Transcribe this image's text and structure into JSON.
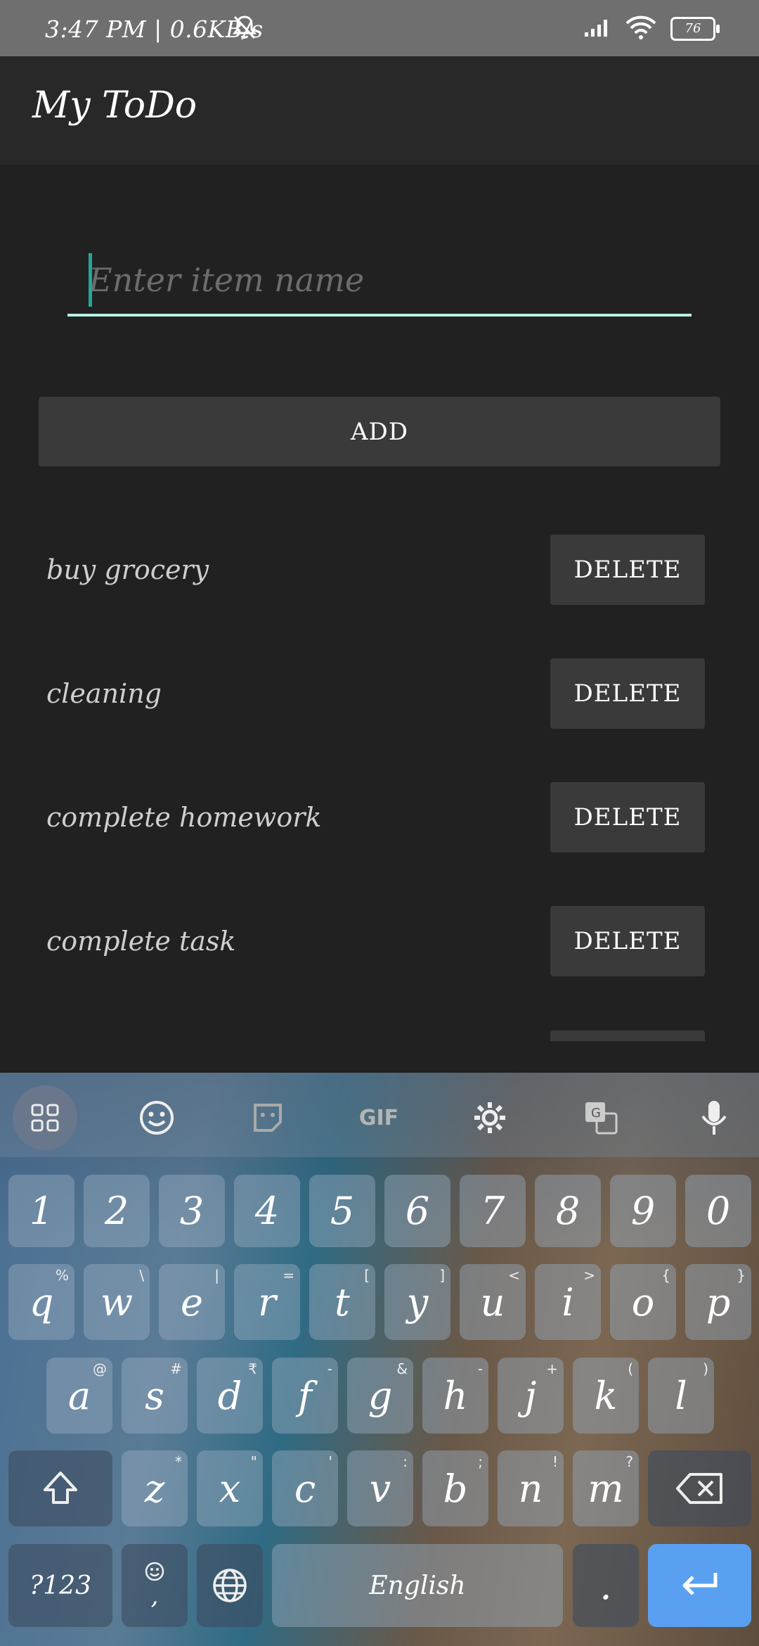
{
  "status_bar": {
    "text": "3:47 PM | 0.6KB/s",
    "battery": "76"
  },
  "app": {
    "title": "My ToDo"
  },
  "input": {
    "placeholder": "Enter item name",
    "value": ""
  },
  "add_button": {
    "label": "ADD"
  },
  "items": [
    {
      "label": "buy grocery",
      "delete_label": "DELETE"
    },
    {
      "label": "cleaning",
      "delete_label": "DELETE"
    },
    {
      "label": "complete homework",
      "delete_label": "DELETE"
    },
    {
      "label": "complete task",
      "delete_label": "DELETE"
    }
  ],
  "keyboard": {
    "toolbar": {
      "apps": "apps-grid-icon",
      "emoji": "emoji-icon",
      "sticker": "sticker-icon",
      "gif": "GIF",
      "settings": "gear-icon",
      "translate": "translate-icon",
      "mic": "mic-icon"
    },
    "numbers": [
      "1",
      "2",
      "3",
      "4",
      "5",
      "6",
      "7",
      "8",
      "9",
      "0"
    ],
    "row1": [
      {
        "k": "q",
        "h": "%"
      },
      {
        "k": "w",
        "h": "\\"
      },
      {
        "k": "e",
        "h": "|"
      },
      {
        "k": "r",
        "h": "="
      },
      {
        "k": "t",
        "h": "["
      },
      {
        "k": "y",
        "h": "]"
      },
      {
        "k": "u",
        "h": "<"
      },
      {
        "k": "i",
        "h": ">"
      },
      {
        "k": "o",
        "h": "{"
      },
      {
        "k": "p",
        "h": "}"
      }
    ],
    "row2": [
      {
        "k": "a",
        "h": "@"
      },
      {
        "k": "s",
        "h": "#"
      },
      {
        "k": "d",
        "h": "₹"
      },
      {
        "k": "f",
        "h": "-"
      },
      {
        "k": "g",
        "h": "&"
      },
      {
        "k": "h",
        "h": "-"
      },
      {
        "k": "j",
        "h": "+"
      },
      {
        "k": "k",
        "h": "("
      },
      {
        "k": "l",
        "h": ")"
      }
    ],
    "row3": [
      {
        "k": "z",
        "h": "*"
      },
      {
        "k": "x",
        "h": "\""
      },
      {
        "k": "c",
        "h": "'"
      },
      {
        "k": "v",
        "h": ":"
      },
      {
        "k": "b",
        "h": ";"
      },
      {
        "k": "n",
        "h": "!"
      },
      {
        "k": "m",
        "h": "?"
      }
    ],
    "symbols_label": "?123",
    "comma_label": ",",
    "space_label": "English",
    "period_label": "."
  }
}
